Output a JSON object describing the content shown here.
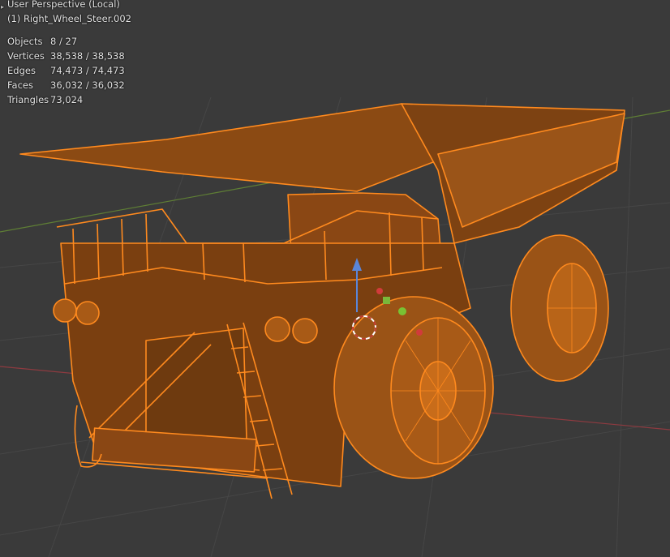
{
  "viewport": {
    "title": "User Perspective (Local)",
    "active_object": "(1) Right_Wheel_Steer.002"
  },
  "stats": [
    {
      "label": "Objects",
      "value": "8 / 27"
    },
    {
      "label": "Vertices",
      "value": "38,538 / 38,538"
    },
    {
      "label": "Edges",
      "value": "74,473 / 74,473"
    },
    {
      "label": "Faces",
      "value": "36,032 / 36,032"
    },
    {
      "label": "Triangles",
      "value": "73,024"
    }
  ],
  "colors": {
    "background": "#3a3a3a",
    "grid": "#474747",
    "x_axis": "#9a3d42",
    "y_axis": "#6a8d3a",
    "selection_wire": "#ff8a1e",
    "selection_fill": "#8a4a14"
  },
  "icons": [
    "collapse-arrow-icon",
    "3d-cursor-icon",
    "gizmo-z-arrow-icon"
  ]
}
